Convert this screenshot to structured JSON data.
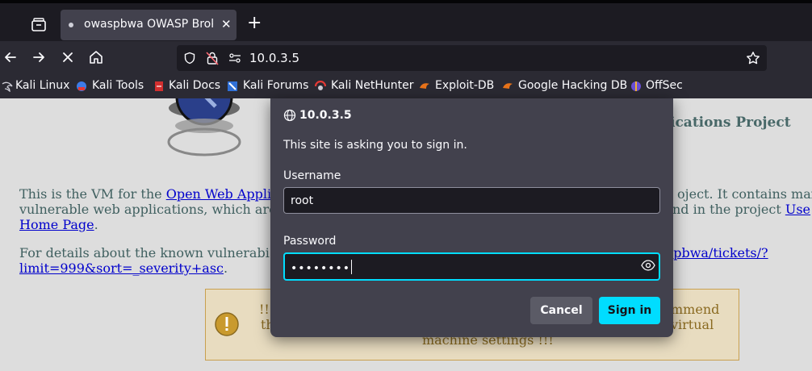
{
  "tab": {
    "title": "owaspbwa OWASP Broke",
    "close": "✕"
  },
  "newtab": "+",
  "urlbar": {
    "url": "10.0.3.5"
  },
  "bookmarks": [
    {
      "label": "Kali Linux"
    },
    {
      "label": "Kali Tools"
    },
    {
      "label": "Kali Docs"
    },
    {
      "label": "Kali Forums"
    },
    {
      "label": "Kali NetHunter"
    },
    {
      "label": "Exploit-DB"
    },
    {
      "label": "Google Hacking DB"
    },
    {
      "label": "OffSec"
    }
  ],
  "page": {
    "project_title": "ications Project",
    "p1_line1_pre": "This is the VM for the ",
    "p1_line1_link": "Open Web Appli",
    "p1_line1_post": "oject. It contains mar",
    "p1_line2_pre": "vulnerable web applications, which are",
    "p1_line2_post": "nd in the project ",
    "p1_line2_link": "Use",
    "p1_line3_link": "Home Page",
    "p1_line3_post": ".",
    "p2_line1_pre": "For details about the known vulnerabi",
    "p2_line1_link": "spbwa/tickets/?",
    "p2_line2_link": "limit=999&sort=_severity+asc",
    "p2_line2_post": ".",
    "warn_l1a": "!!",
    "warn_l1b": "mmend",
    "warn_l2a": "th",
    "warn_l2b": "virtual",
    "warn_l3": "machine settings !!!"
  },
  "dialog": {
    "host": "10.0.3.5",
    "message": "This site is asking you to sign in.",
    "username_label": "Username",
    "username_value": "root",
    "password_label": "Password",
    "password_value": "••••••••",
    "cancel": "Cancel",
    "signin": "Sign in"
  },
  "colors": {
    "accent": "#00ddff",
    "dialog_bg": "#42414d",
    "chrome_bg": "#2b2a33"
  }
}
